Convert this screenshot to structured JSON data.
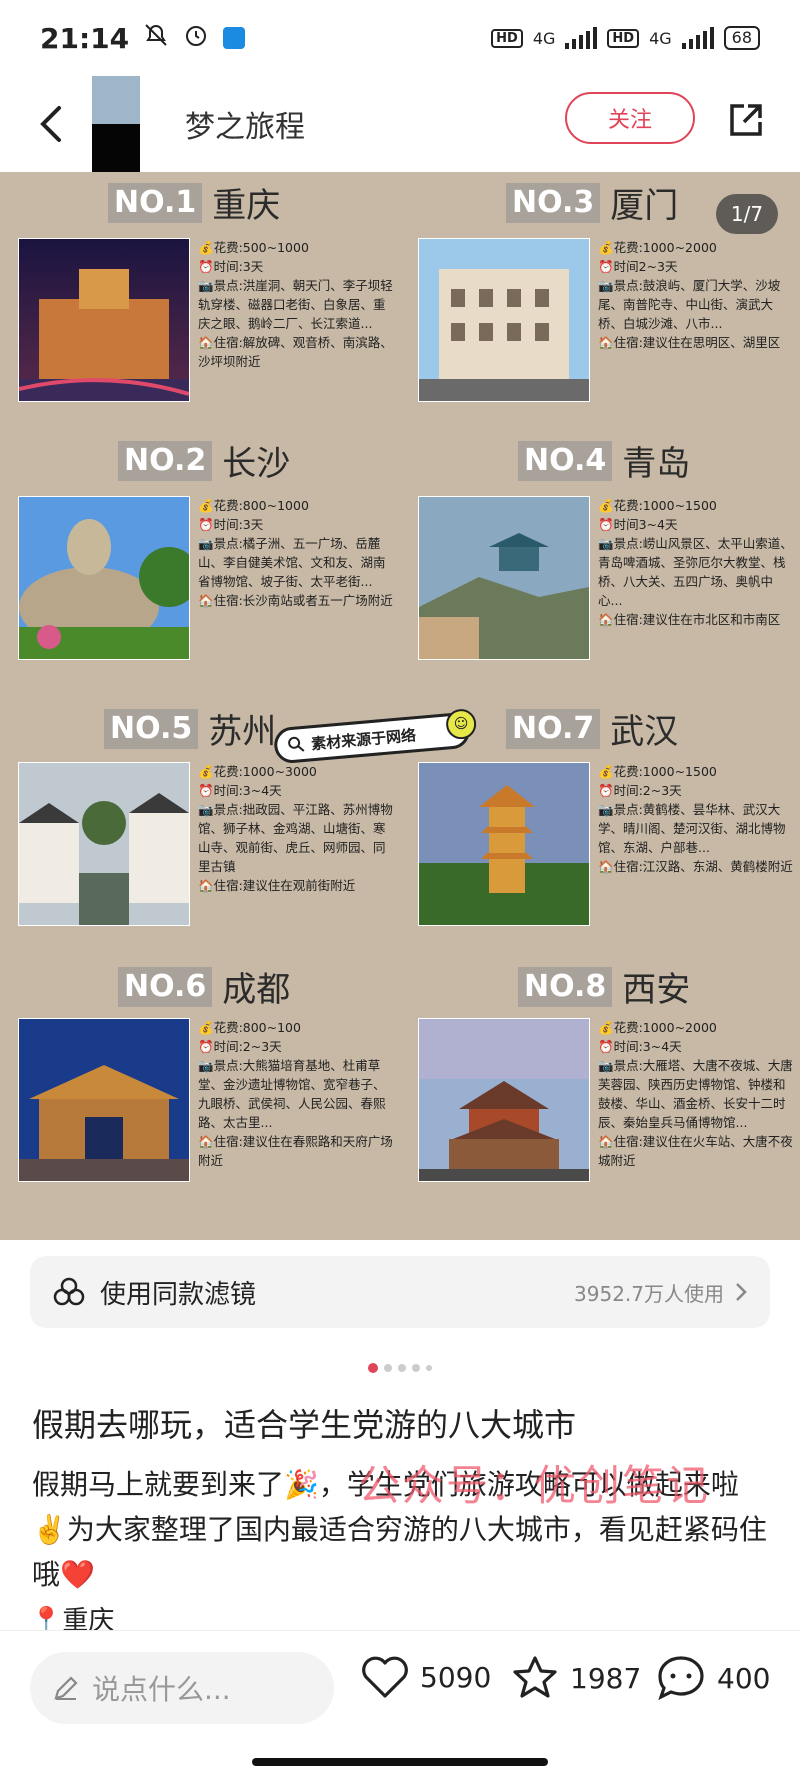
{
  "status_bar": {
    "time": "21:14",
    "network_1": "4G",
    "network_2": "4G",
    "hd_1": "HD",
    "hd_2": "HD",
    "battery": "68"
  },
  "header": {
    "author_name": "梦之旅程",
    "follow_label": "关注"
  },
  "poster": {
    "page_indicator": "1/7",
    "watermark_tag": "素材来源于网络",
    "cities": [
      {
        "rank": "NO.1",
        "name": "重庆",
        "lines": [
          "💰花费:500~1000",
          "⏰时间:3天",
          "📷景点:洪崖洞、朝天门、李子坝轻轨穿楼、磁器口老街、白象居、重庆之眼、鹅岭二厂、长江索道...",
          "🏠住宿:解放碑、观音桥、南滨路、沙坪坝附近"
        ]
      },
      {
        "rank": "NO.3",
        "name": "厦门",
        "lines": [
          "💰花费:1000~2000",
          "⏰时间2~3天",
          "📷景点:鼓浪屿、厦门大学、沙坡尾、南普陀寺、中山街、演武大桥、白城沙滩、八市...",
          "🏠住宿:建议住在思明区、湖里区"
        ]
      },
      {
        "rank": "NO.2",
        "name": "长沙",
        "lines": [
          "💰花费:800~1000",
          "⏰时间:3天",
          "📷景点:橘子洲、五一广场、岳麓山、李自健美术馆、文和友、湖南省博物馆、坡子街、太平老街...",
          "🏠住宿:长沙南站或者五一广场附近"
        ]
      },
      {
        "rank": "NO.4",
        "name": "青岛",
        "lines": [
          "💰花费:1000~1500",
          "⏰时间3~4天",
          "📷景点:崂山风景区、太平山索道、青岛啤酒城、圣弥厄尔大教堂、栈桥、八大关、五四广场、奥帆中心...",
          "🏠住宿:建议住在市北区和市南区"
        ]
      },
      {
        "rank": "NO.5",
        "name": "苏州",
        "lines": [
          "💰花费:1000~3000",
          "⏰时间:3~4天",
          "📷景点:拙政园、平江路、苏州博物馆、狮子林、金鸡湖、山塘街、寒山寺、观前街、虎丘、网师园、同里古镇",
          "🏠住宿:建议住在观前街附近"
        ]
      },
      {
        "rank": "NO.7",
        "name": "武汉",
        "lines": [
          "💰花费:1000~1500",
          "⏰时间:2~3天",
          "📷景点:黄鹤楼、昙华林、武汉大学、晴川阁、楚河汉街、湖北博物馆、东湖、户部巷...",
          "🏠住宿:江汉路、东湖、黄鹤楼附近"
        ]
      },
      {
        "rank": "NO.6",
        "name": "成都",
        "lines": [
          "💰花费:800~100",
          "⏰时间:2~3天",
          "📷景点:大熊猫培育基地、杜甫草堂、金沙遗址博物馆、宽窄巷子、九眼桥、武侯祠、人民公园、春熙路、太古里...",
          "🏠住宿:建议住在春熙路和天府广场附近"
        ]
      },
      {
        "rank": "NO.8",
        "name": "西安",
        "lines": [
          "💰花费:1000~2000",
          "⏰时间:3~4天",
          "📷景点:大雁塔、大唐不夜城、大唐芙蓉园、陕西历史博物馆、钟楼和鼓楼、华山、酒金桥、长安十二时辰、秦始皇兵马俑博物馆...",
          "🏠住宿:建议住在火车站、大唐不夜城附近"
        ]
      }
    ]
  },
  "filter": {
    "label": "使用同款滤镜",
    "count": "3952.7万人使用"
  },
  "post": {
    "title": "假期去哪玩，适合学生党游的八大城市",
    "body": "假期马上就要到来了🎉，学生党们旅游攻略可以做起来啦✌️为大家整理了国内最适合穷游的八大城市，看见赶紧码住哦❤️",
    "watermark": "公众号：优创笔记",
    "location": "📍重庆"
  },
  "bottom_bar": {
    "comment_placeholder": "说点什么...",
    "likes": "5090",
    "favorites": "1987",
    "comments": "400"
  },
  "colors": {
    "accent": "#e04458",
    "poster_bg": "#c7b9a5",
    "rank_bg": "#a8a29b"
  }
}
